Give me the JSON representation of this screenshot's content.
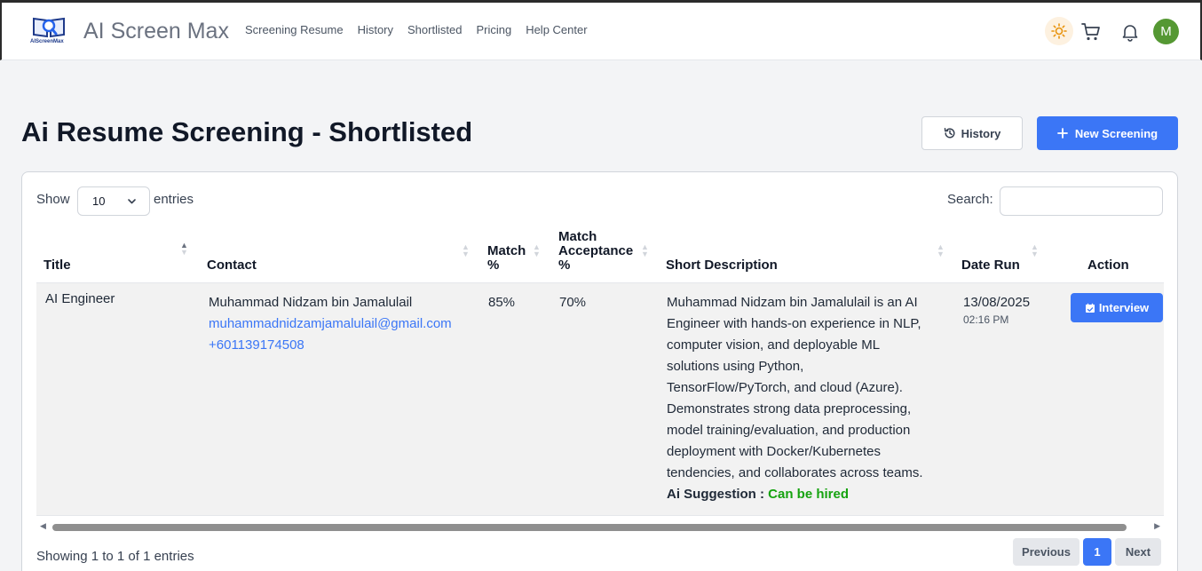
{
  "app": {
    "logo_text": "AIScreenMax",
    "name": "AI Screen Max"
  },
  "nav": {
    "items": [
      "Screening Resume",
      "History",
      "Shortlisted",
      "Pricing",
      "Help Center"
    ]
  },
  "header_icons": {
    "theme": "sun-icon",
    "cart": "cart-icon",
    "notifications": "bell-icon",
    "avatar_initial": "M",
    "avatar_color": "#559833"
  },
  "page": {
    "title": "Ai Resume Screening - Shortlisted",
    "history_button": "History",
    "new_button": "New Screening"
  },
  "table_controls": {
    "show_label": "Show",
    "page_length": "10",
    "entries_label": "entries",
    "search_label": "Search:",
    "search_value": ""
  },
  "columns": {
    "title": "Title",
    "contact": "Contact",
    "match_1": "Match",
    "match_2": "%",
    "acceptance_1": "Match",
    "acceptance_2": "Acceptance",
    "acceptance_3": "%",
    "description": "Short Description",
    "date": "Date Run",
    "action": "Action"
  },
  "rows": [
    {
      "title": "AI Engineer",
      "name": "Muhammad Nidzam bin Jamalulail",
      "email": "muhammadnidzamjamalulail@gmail.com",
      "phone": "+601139174508",
      "match": "85%",
      "acceptance": "70%",
      "description_lines": [
        "Muhammad Nidzam bin Jamalulail is an AI",
        "Engineer with hands-on experience in NLP,",
        "computer vision, and deployable ML",
        "solutions using Python,",
        "TensorFlow/PyTorch, and cloud (Azure).",
        "Demonstrates strong data preprocessing,",
        "model training/evaluation, and production",
        "deployment with Docker/Kubernetes",
        "tendencies, and collaborates across teams."
      ],
      "suggestion_label": "Ai Suggestion :",
      "suggestion_value": "Can be hired",
      "date": "13/08/2025",
      "time": "02:16 PM",
      "action_label": "Interview"
    }
  ],
  "footer": {
    "info": "Showing 1 to 1 of 1 entries",
    "previous": "Previous",
    "current_page": "1",
    "next": "Next"
  },
  "colors": {
    "primary": "#3b76f6",
    "success": "#16a310"
  }
}
